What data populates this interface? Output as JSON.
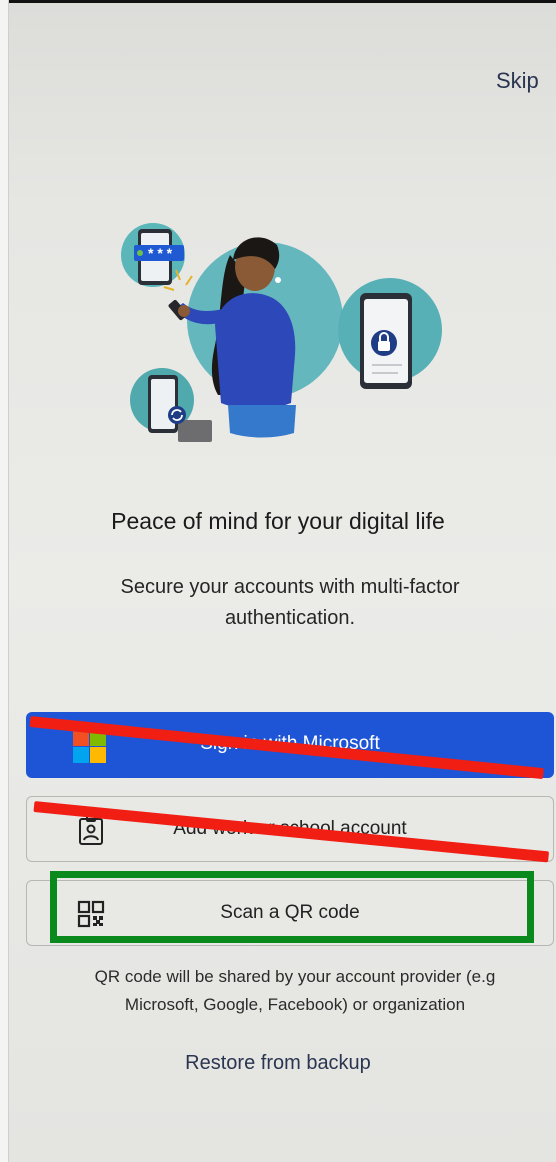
{
  "header": {
    "skip_label": "Skip"
  },
  "onboarding": {
    "headline": "Peace of mind for your digital life",
    "subtitle": "Secure your accounts with multi-factor authentication.",
    "hero_password_mask": "* * *"
  },
  "buttons": {
    "sign_in_microsoft": "Sign in with Microsoft",
    "add_work_school": "Add work or school account",
    "scan_qr": "Scan a QR code"
  },
  "qr_note": "QR code will be shared by your account provider (e.g Microsoft, Google, Facebook) or organization",
  "restore_label": "Restore from backup",
  "icons": {
    "microsoft_logo": "microsoft-logo-icon",
    "badge": "id-badge-icon",
    "qr": "qr-code-icon"
  },
  "colors": {
    "primary_button": "#1e55d6",
    "annotation_strike": "#f11e14",
    "annotation_highlight": "#0a8a1c",
    "link_text": "#2a3550",
    "ms_red": "#f25022",
    "ms_green": "#7fba00",
    "ms_blue": "#00a4ef",
    "ms_yellow": "#ffb900"
  }
}
